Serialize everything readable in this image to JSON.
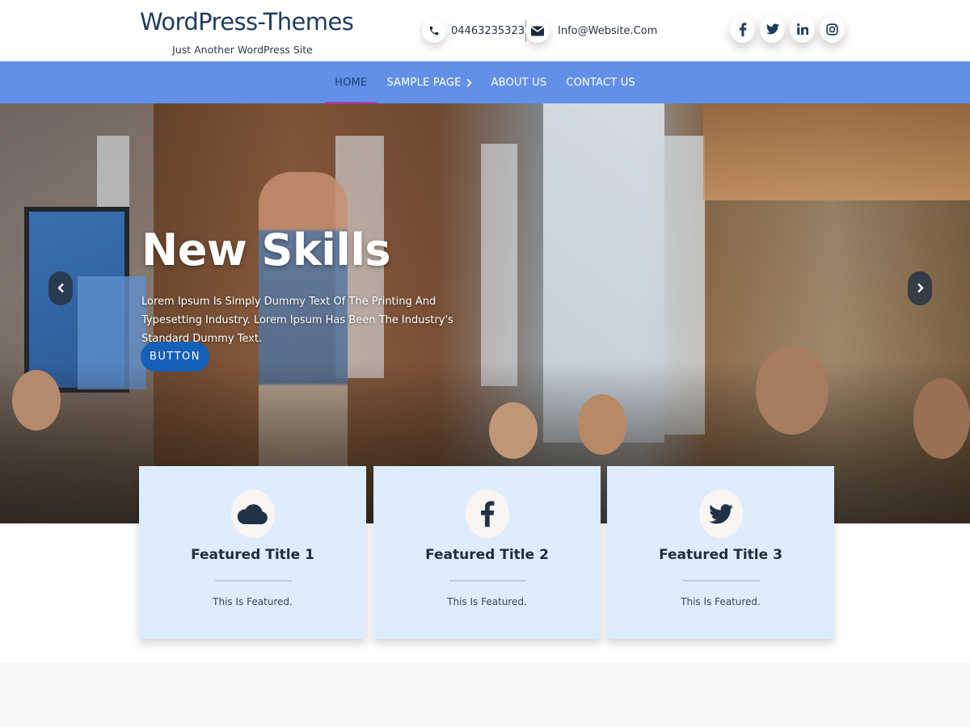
{
  "header": {
    "site_title": "WordPress-Themes",
    "tagline": "Just Another WordPress Site",
    "phone": "04463235323",
    "email": "Info@Website.Com",
    "phone_icon": "phone-icon",
    "email_icon": "envelope-icon",
    "social": [
      {
        "name": "facebook-icon"
      },
      {
        "name": "twitter-icon"
      },
      {
        "name": "linkedin-icon"
      },
      {
        "name": "instagram-icon"
      }
    ]
  },
  "nav": {
    "items": [
      {
        "label": "HOME",
        "active": true
      },
      {
        "label": "SAMPLE PAGE",
        "has_submenu": true
      },
      {
        "label": "ABOUT US"
      },
      {
        "label": "CONTACT US"
      }
    ]
  },
  "hero": {
    "title": "New Skills",
    "text": "Lorem Ipsum Is Simply Dummy Text Of The Printing And Typesetting Industry. Lorem Ipsum Has Been The Industry's Standard Dummy Text.",
    "button_label": "BUTTON",
    "prev_icon": "chevron-left-icon",
    "next_icon": "chevron-right-icon"
  },
  "featured": [
    {
      "icon": "cloud-icon",
      "title": "Featured Title 1",
      "text": "This Is Featured."
    },
    {
      "icon": "facebook-icon",
      "title": "Featured Title 2",
      "text": "This Is Featured."
    },
    {
      "icon": "twitter-icon",
      "title": "Featured Title 3",
      "text": "This Is Featured."
    }
  ],
  "colors": {
    "nav_background": "#6290e8",
    "nav_active_underline": "#b133c9",
    "button": "#1560b8",
    "feature_card": "#deedfe",
    "title": "#1f3c5d"
  }
}
